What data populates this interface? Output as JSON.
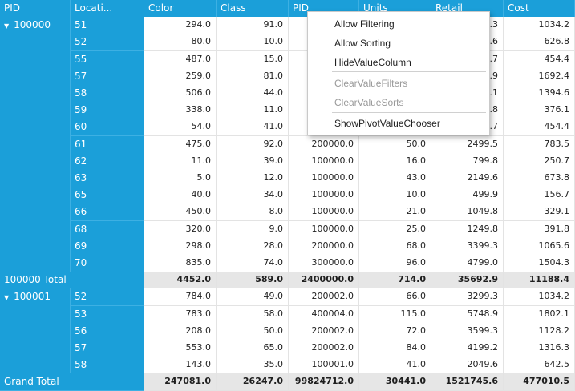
{
  "columns": [
    "PID",
    "Locati...",
    "Color",
    "Class",
    "PID",
    "Units",
    "Retail",
    "Cost"
  ],
  "groups": [
    {
      "pid": "100000",
      "rows": [
        {
          "loc": "51",
          "values": [
            "294.0",
            "91.0",
            "",
            "",
            "9.3",
            "1034.2"
          ]
        },
        {
          "loc": "52",
          "values": [
            "80.0",
            "10.0",
            "",
            "",
            "9.6",
            "626.8"
          ]
        },
        {
          "loc": "55",
          "values": [
            "487.0",
            "15.0",
            "",
            "",
            "9.7",
            "454.4"
          ]
        },
        {
          "loc": "57",
          "values": [
            "259.0",
            "81.0",
            "",
            "",
            "8.9",
            "1692.4"
          ]
        },
        {
          "loc": "58",
          "values": [
            "506.0",
            "44.0",
            "",
            "",
            "9.1",
            "1394.6"
          ]
        },
        {
          "loc": "59",
          "values": [
            "338.0",
            "11.0",
            "",
            "",
            "9.8",
            "376.1"
          ]
        },
        {
          "loc": "60",
          "values": [
            "54.0",
            "41.0",
            "",
            "",
            "9.7",
            "454.4"
          ]
        },
        {
          "loc": "61",
          "values": [
            "475.0",
            "92.0",
            "200000.0",
            "50.0",
            "2499.5",
            "783.5"
          ]
        },
        {
          "loc": "62",
          "values": [
            "11.0",
            "39.0",
            "100000.0",
            "16.0",
            "799.8",
            "250.7"
          ]
        },
        {
          "loc": "63",
          "values": [
            "5.0",
            "12.0",
            "100000.0",
            "43.0",
            "2149.6",
            "673.8"
          ]
        },
        {
          "loc": "65",
          "values": [
            "40.0",
            "34.0",
            "100000.0",
            "10.0",
            "499.9",
            "156.7"
          ]
        },
        {
          "loc": "66",
          "values": [
            "450.0",
            "8.0",
            "100000.0",
            "21.0",
            "1049.8",
            "329.1"
          ]
        },
        {
          "loc": "68",
          "values": [
            "320.0",
            "9.0",
            "100000.0",
            "25.0",
            "1249.8",
            "391.8"
          ]
        },
        {
          "loc": "69",
          "values": [
            "298.0",
            "28.0",
            "200000.0",
            "68.0",
            "3399.3",
            "1065.6"
          ]
        },
        {
          "loc": "70",
          "values": [
            "835.0",
            "74.0",
            "300000.0",
            "96.0",
            "4799.0",
            "1504.3"
          ]
        }
      ],
      "total_label": "100000 Total",
      "total": [
        "4452.0",
        "589.0",
        "2400000.0",
        "714.0",
        "35692.9",
        "11188.4"
      ]
    },
    {
      "pid": "100001",
      "rows": [
        {
          "loc": "52",
          "values": [
            "784.0",
            "49.0",
            "200002.0",
            "66.0",
            "3299.3",
            "1034.2"
          ]
        },
        {
          "loc": "53",
          "values": [
            "783.0",
            "58.0",
            "400004.0",
            "115.0",
            "5748.9",
            "1802.1"
          ]
        },
        {
          "loc": "56",
          "values": [
            "208.0",
            "50.0",
            "200002.0",
            "72.0",
            "3599.3",
            "1128.2"
          ]
        },
        {
          "loc": "57",
          "values": [
            "553.0",
            "65.0",
            "200002.0",
            "84.0",
            "4199.2",
            "1316.3"
          ]
        },
        {
          "loc": "58",
          "values": [
            "143.0",
            "35.0",
            "100001.0",
            "41.0",
            "2049.6",
            "642.5"
          ]
        }
      ]
    }
  ],
  "grand_total": {
    "label": "Grand Total",
    "values": [
      "247081.0",
      "26247.0",
      "99824712.0",
      "30441.0",
      "1521745.6",
      "477010.5"
    ]
  },
  "context_menu": {
    "items": [
      {
        "label": "Allow Filtering",
        "enabled": true
      },
      {
        "label": "Allow Sorting",
        "enabled": true
      },
      {
        "label": "HideValueColumn",
        "enabled": true
      },
      {
        "label": "ClearValueFilters",
        "enabled": false
      },
      {
        "label": "ClearValueSorts",
        "enabled": false
      },
      {
        "label": "ShowPivotValueChooser",
        "enabled": true
      }
    ]
  },
  "icons": {
    "expand": "expanded-arrow-icon"
  },
  "colors": {
    "header": "#1b9fd9",
    "total_row": "#e6e6e6"
  }
}
